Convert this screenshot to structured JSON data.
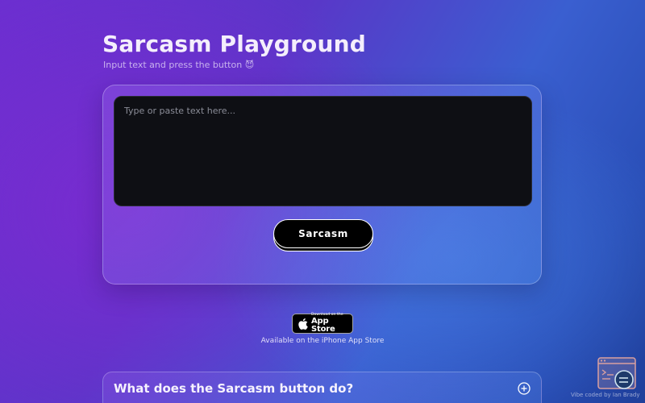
{
  "header": {
    "title": "Sarcasm Playground",
    "subtitle": "Input text and press the button 😈"
  },
  "editor": {
    "placeholder": "Type or paste text here...",
    "value": ""
  },
  "actions": {
    "sarcasm_label": "Sarcasm"
  },
  "app_store": {
    "badge_small": "Download on the",
    "badge_big": "App Store",
    "caption": "Available on the iPhone App Store",
    "icon": "apple-icon"
  },
  "faq": {
    "items": [
      {
        "question": "What does the Sarcasm button do?",
        "icon": "plus-icon"
      }
    ]
  },
  "footer": {
    "credit": "Vibe coded by Ian Brady",
    "icon": "terminal-window-icon"
  },
  "colors": {
    "textarea_bg": "#0e0f14",
    "button_bg": "#000000",
    "accent_purple": "#7b2fd6",
    "accent_blue": "#3a6fdc"
  }
}
